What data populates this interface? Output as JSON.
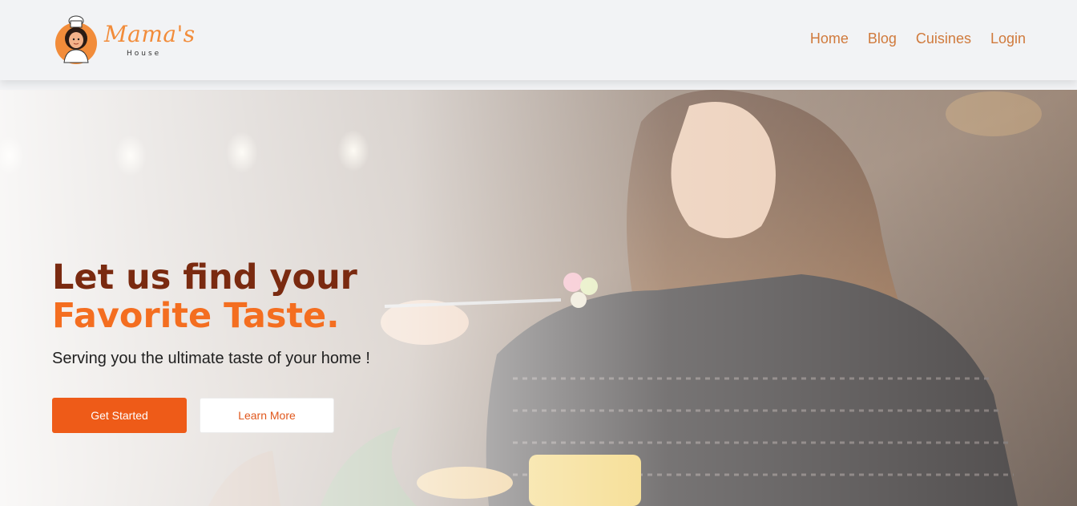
{
  "brand": {
    "name": "Mama's",
    "subtitle": "House",
    "accent_color": "#f28c3a"
  },
  "nav": {
    "items": [
      {
        "label": "Home"
      },
      {
        "label": "Blog"
      },
      {
        "label": "Cuisines"
      },
      {
        "label": "Login"
      }
    ],
    "link_color": "#d07a3c"
  },
  "hero": {
    "headline_line1": "Let us find your",
    "headline_line2": "Favorite Taste.",
    "subheadline": "Serving you the ultimate taste of your home !",
    "primary_button": "Get Started",
    "secondary_button": "Learn More",
    "background_image": "woman-eating-pasta-photo",
    "colors": {
      "headline_dark": "#7a2a10",
      "headline_accent": "#f46e20",
      "primary_button": "#ee5b18"
    }
  }
}
